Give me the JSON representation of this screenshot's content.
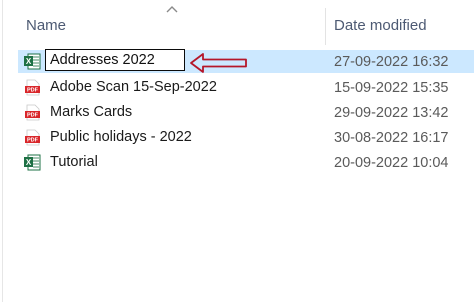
{
  "header": {
    "name_label": "Name",
    "date_label": "Date modified"
  },
  "files": [
    {
      "name": "Addresses 2022",
      "date": "27-09-2022 16:32",
      "icon": "excel-icon",
      "renaming": true
    },
    {
      "name": "Adobe Scan 15-Sep-2022",
      "date": "15-09-2022 15:35",
      "icon": "pdf-icon"
    },
    {
      "name": "Marks Cards",
      "date": "29-09-2022 13:42",
      "icon": "pdf-icon"
    },
    {
      "name": "Public holidays - 2022",
      "date": "30-08-2022 16:17",
      "icon": "pdf-icon"
    },
    {
      "name": "Tutorial",
      "date": "20-09-2022 10:04",
      "icon": "excel-icon"
    }
  ],
  "colors": {
    "selection": "#cce8ff",
    "excel_green": "#1e7145",
    "pdf_red": "#d9262a",
    "annotation_red": "#b5172a"
  }
}
